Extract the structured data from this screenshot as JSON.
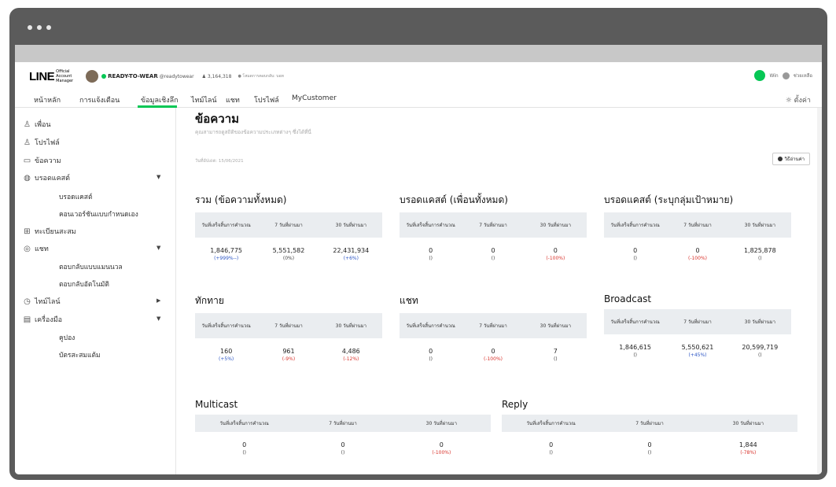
{
  "header": {
    "logo": "LINE",
    "logo_sub": "Official Account Manager",
    "account_name": "READY-TO-WEAR",
    "account_id": "@readytowear",
    "friends": "3,164,318",
    "mode": "โหมดการตอบกลับ: บอท",
    "user": "Win",
    "help": "ช่วยเหลือ"
  },
  "nav": {
    "items": [
      "หน้าหลัก",
      "การแจ้งเตือน",
      "ข้อมูลเชิงลึก",
      "ไทม์ไลน์",
      "แชท",
      "โปรไฟล์",
      "MyCustomer"
    ],
    "settings": "ตั้งค่า"
  },
  "sidebar": {
    "items": [
      {
        "icon": "♙",
        "label": "เพื่อน"
      },
      {
        "icon": "♙",
        "label": "โปรไฟล์"
      },
      {
        "icon": "▭",
        "label": "ข้อความ"
      },
      {
        "icon": "◍",
        "label": "บรอดแคสต์"
      },
      {
        "icon": "⊞",
        "label": "ทะเบียนสะสม"
      },
      {
        "icon": "◎",
        "label": "แชท"
      },
      {
        "icon": "◷",
        "label": "ไทม์ไลน์"
      },
      {
        "icon": "▤",
        "label": "เครื่องมือ"
      }
    ],
    "subitems": {
      "broadcast_1": "บรอดแคสต์",
      "broadcast_2": "คอนเวอร์ชันแบบกำหนดเอง",
      "chat_1": "ตอบกลับแบบแมนนวล",
      "chat_2": "ตอบกลับอัตโนมัติ",
      "tools_1": "คูปอง",
      "tools_2": "บัตรสะสมแต้ม"
    }
  },
  "content": {
    "title": "ข้อความ",
    "description": "คุณสามารถดูสถิติของข้อความประเภทต่างๆ ซึ่งได้ที่นี่",
    "updated": "วันที่อัปเดต: 15/06/2021",
    "howto": "วิธีอ่านค่า",
    "stats": [
      {
        "title": "รวม (ข้อความทั้งหมด)",
        "headers": [
          "วันที่เสร็จสิ้นการคำนวณ",
          "7 วันที่ผ่านมา",
          "30 วันที่ผ่านมา"
        ],
        "values": [
          "1,846,775",
          "5,551,582",
          "22,431,934"
        ],
        "changes": [
          [
            "(+999%--)",
            "blue"
          ],
          [
            "(0%)",
            "gray"
          ],
          [
            "(+6%)",
            "blue"
          ]
        ]
      },
      {
        "title": "บรอดแคสต์ (เพื่อนทั้งหมด)",
        "headers": [
          "วันที่เสร็จสิ้นการคำนวณ",
          "7 วันที่ผ่านมา",
          "30 วันที่ผ่านมา"
        ],
        "values": [
          "0",
          "0",
          "0"
        ],
        "changes": [
          [
            "()",
            "gray"
          ],
          [
            "()",
            "gray"
          ],
          [
            "(-100%)",
            "red"
          ]
        ]
      },
      {
        "title": "บรอดแคสต์ (ระบุกลุ่มเป้าหมาย)",
        "headers": [
          "วันที่เสร็จสิ้นการคำนวณ",
          "7 วันที่ผ่านมา",
          "30 วันที่ผ่านมา"
        ],
        "values": [
          "0",
          "0",
          "1,825,878"
        ],
        "changes": [
          [
            "()",
            "gray"
          ],
          [
            "(-100%)",
            "red"
          ],
          [
            "()",
            "gray"
          ]
        ]
      },
      {
        "title": "ทักทาย",
        "headers": [
          "วันที่เสร็จสิ้นการคำนวณ",
          "7 วันที่ผ่านมา",
          "30 วันที่ผ่านมา"
        ],
        "values": [
          "160",
          "961",
          "4,486"
        ],
        "changes": [
          [
            "(+5%)",
            "blue"
          ],
          [
            "(-9%)",
            "red"
          ],
          [
            "(-12%)",
            "red"
          ]
        ]
      },
      {
        "title": "แชท",
        "headers": [
          "วันที่เสร็จสิ้นการคำนวณ",
          "7 วันที่ผ่านมา",
          "30 วันที่ผ่านมา"
        ],
        "values": [
          "0",
          "0",
          "7"
        ],
        "changes": [
          [
            "()",
            "gray"
          ],
          [
            "(-100%)",
            "red"
          ],
          [
            "()",
            "gray"
          ]
        ]
      },
      {
        "title": "Broadcast",
        "headers": [
          "วันที่เสร็จสิ้นการคำนวณ",
          "7 วันที่ผ่านมา",
          "30 วันที่ผ่านมา"
        ],
        "values": [
          "1,846,615",
          "5,550,621",
          "20,599,719"
        ],
        "changes": [
          [
            "()",
            "gray"
          ],
          [
            "(+45%)",
            "blue"
          ],
          [
            "()",
            "gray"
          ]
        ]
      },
      {
        "title": "Multicast",
        "headers": [
          "วันที่เสร็จสิ้นการคำนวณ",
          "7 วันที่ผ่านมา",
          "30 วันที่ผ่านมา"
        ],
        "values": [
          "0",
          "0",
          "0"
        ],
        "changes": [
          [
            "()",
            "gray"
          ],
          [
            "()",
            "gray"
          ],
          [
            "(-100%)",
            "red"
          ]
        ]
      },
      {
        "title": "Reply",
        "headers": [
          "วันที่เสร็จสิ้นการคำนวณ",
          "7 วันที่ผ่านมา",
          "30 วันที่ผ่านมา"
        ],
        "values": [
          "0",
          "0",
          "1,844"
        ],
        "changes": [
          [
            "()",
            "gray"
          ],
          [
            "()",
            "gray"
          ],
          [
            "(-78%)",
            "red"
          ]
        ]
      }
    ]
  },
  "colors": {
    "accent": "#06c755",
    "positive": "#2d56c5",
    "negative": "#d9332c"
  }
}
